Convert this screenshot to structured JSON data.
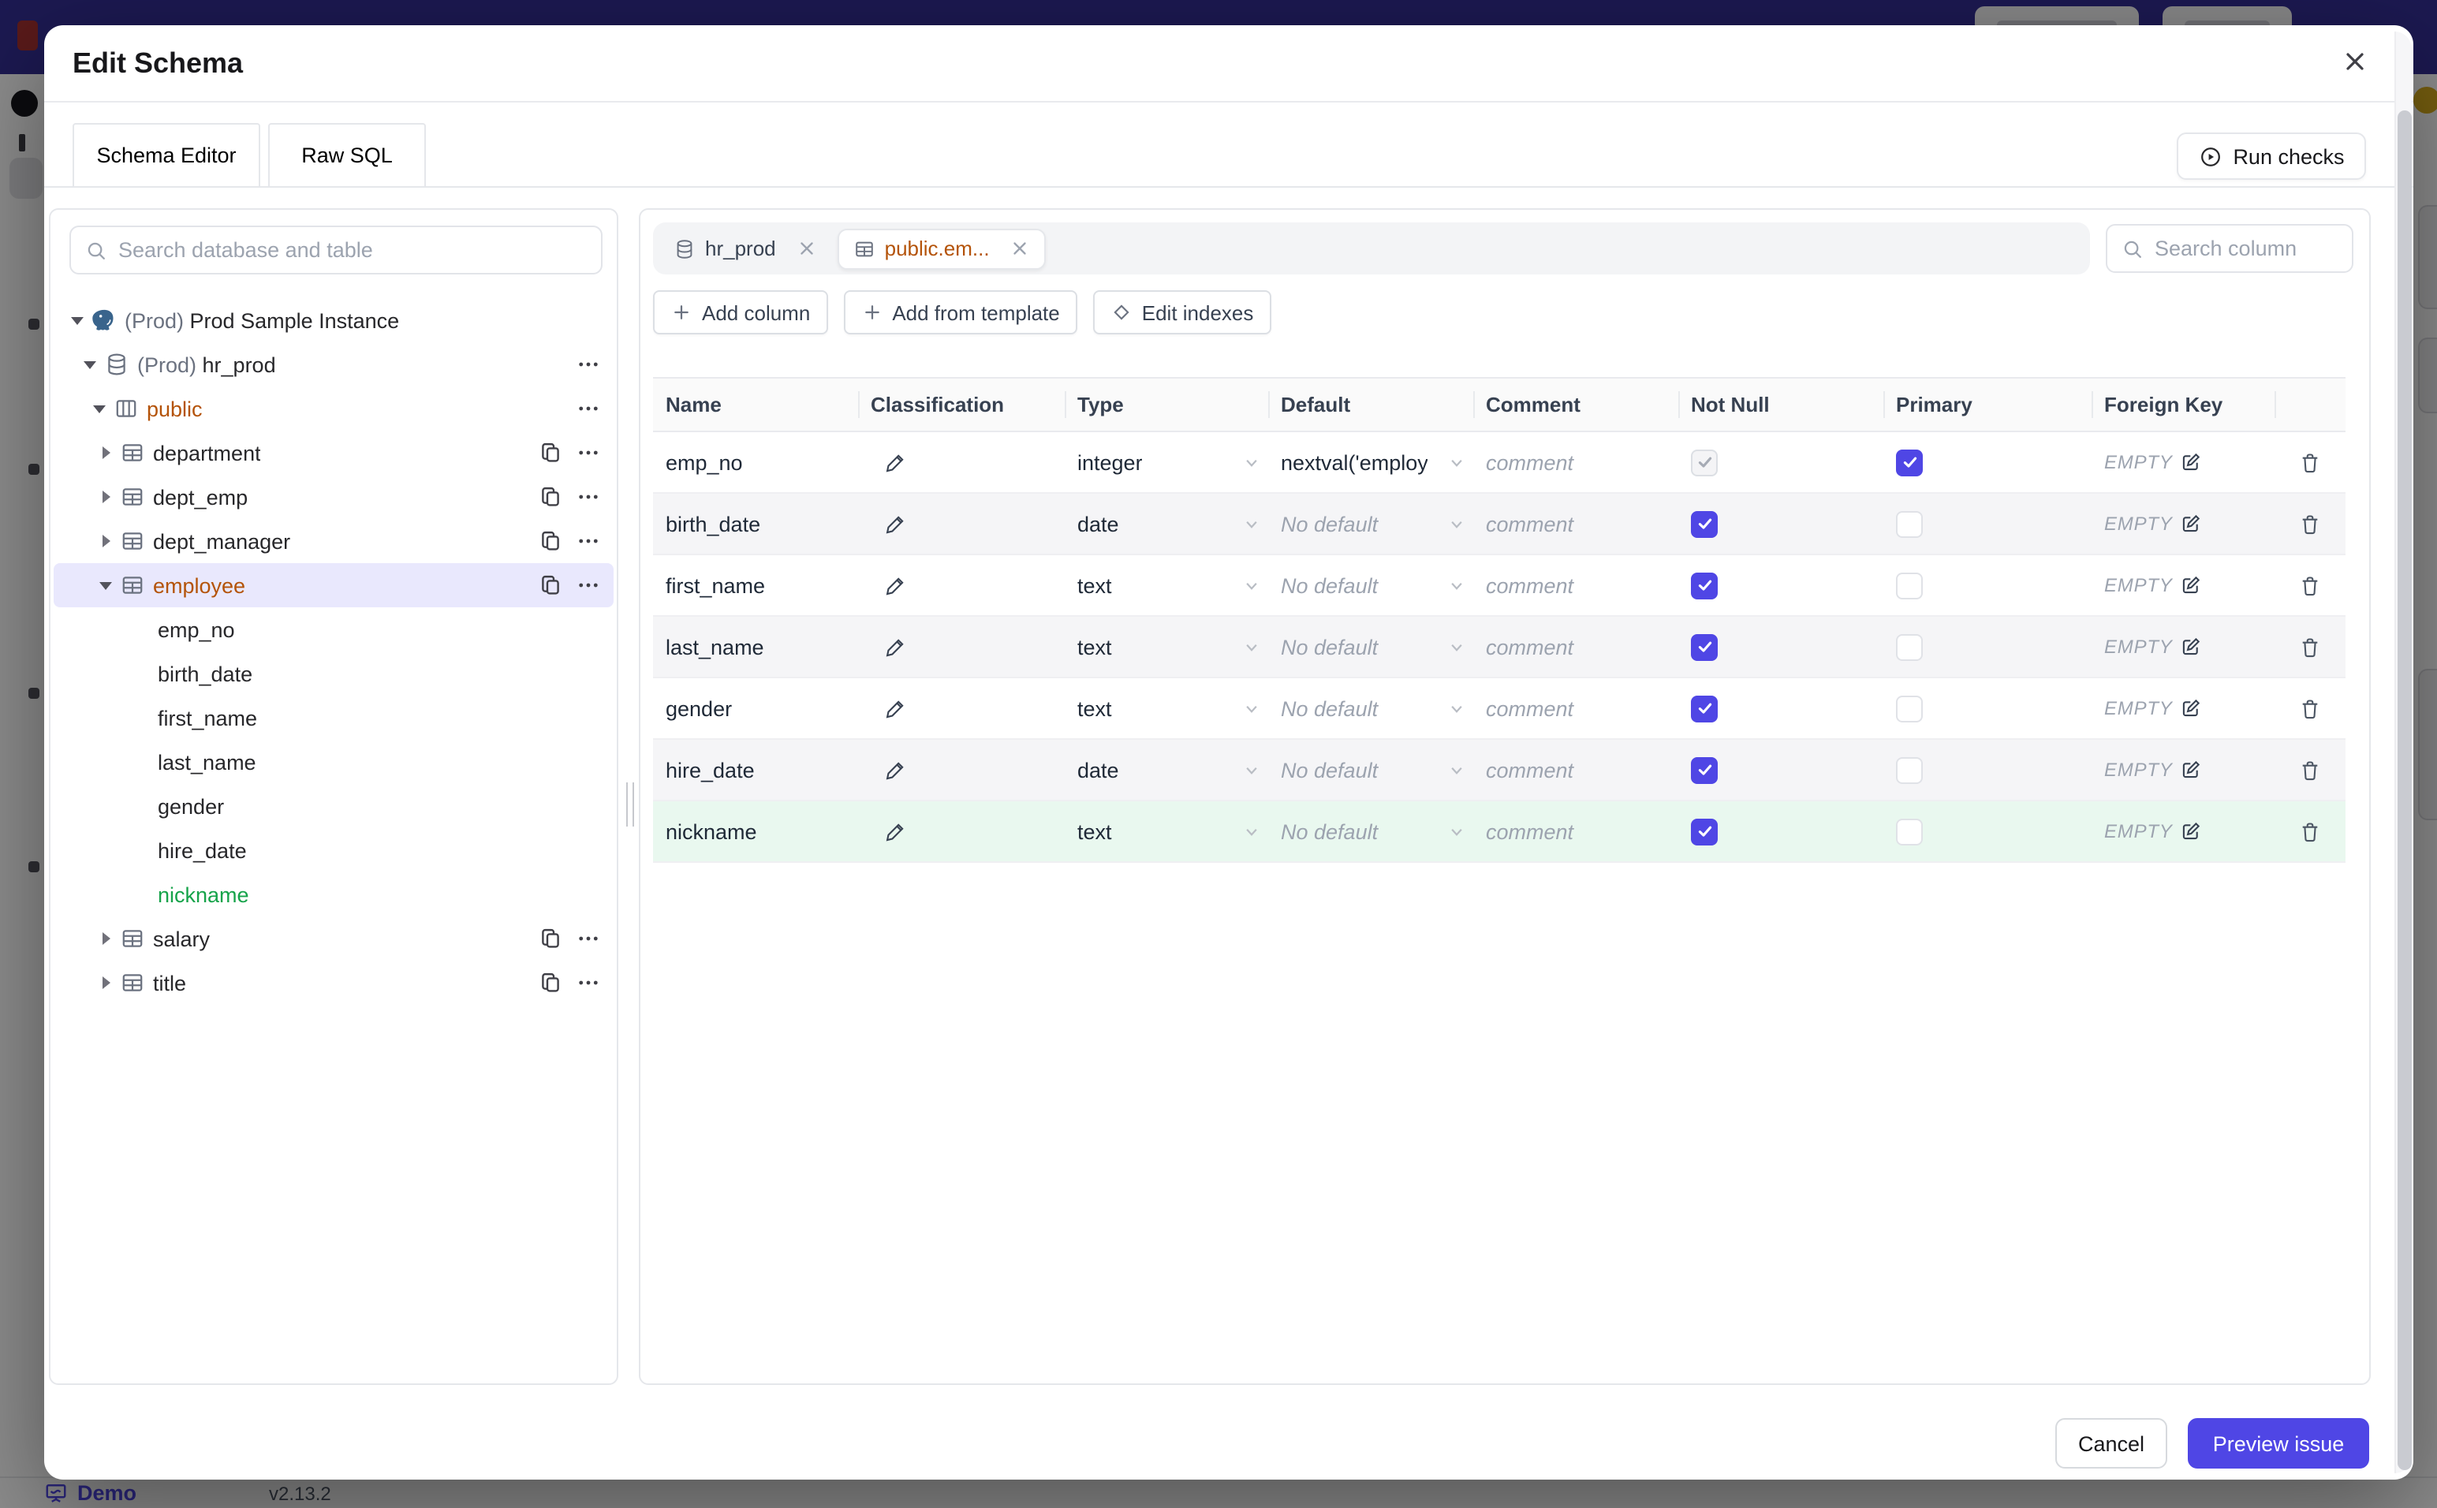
{
  "colors": {
    "accent": "#4f46e5",
    "topbar": "#332e94",
    "modified_amber": "#b45309",
    "added_green": "#16a34a",
    "added_row_bg": "#e9f8ef",
    "selected_tree_bg": "#e9e8fd"
  },
  "backdrop": {
    "footer": {
      "demo_label": "Demo",
      "version": "v2.13.2"
    }
  },
  "modal": {
    "title": "Edit Schema",
    "tabs": [
      {
        "label": "Schema Editor",
        "active": true
      },
      {
        "label": "Raw SQL",
        "active": false
      }
    ],
    "run_checks_label": "Run checks",
    "footer": {
      "cancel_label": "Cancel",
      "preview_label": "Preview issue"
    }
  },
  "sidebar": {
    "search_placeholder": "Search database and table",
    "tree": [
      {
        "level": 0,
        "icon": "postgres",
        "arrow": "expanded",
        "prefix": "(Prod) ",
        "label": "Prod Sample Instance"
      },
      {
        "level": 1,
        "icon": "database",
        "arrow": "expanded",
        "prefix": "(Prod) ",
        "label": "hr_prod",
        "dots": true
      },
      {
        "level": 2,
        "icon": "schema",
        "arrow": "expanded",
        "label": "public",
        "dots": true,
        "state": "modified"
      },
      {
        "level": 3,
        "icon": "table",
        "arrow": "collapsed",
        "label": "department",
        "copy": true,
        "dots": true
      },
      {
        "level": 3,
        "icon": "table",
        "arrow": "collapsed",
        "label": "dept_emp",
        "copy": true,
        "dots": true
      },
      {
        "level": 3,
        "icon": "table",
        "arrow": "collapsed",
        "label": "dept_manager",
        "copy": true,
        "dots": true
      },
      {
        "level": 3,
        "icon": "table",
        "arrow": "expanded",
        "label": "employee",
        "copy": true,
        "dots": true,
        "state": "modified",
        "selected": true
      },
      {
        "level": 4,
        "label": "emp_no"
      },
      {
        "level": 4,
        "label": "birth_date"
      },
      {
        "level": 4,
        "label": "first_name"
      },
      {
        "level": 4,
        "label": "last_name"
      },
      {
        "level": 4,
        "label": "gender"
      },
      {
        "level": 4,
        "label": "hire_date"
      },
      {
        "level": 4,
        "label": "nickname",
        "state": "added"
      },
      {
        "level": 3,
        "icon": "table",
        "arrow": "collapsed",
        "label": "salary",
        "copy": true,
        "dots": true
      },
      {
        "level": 3,
        "icon": "table",
        "arrow": "collapsed",
        "label": "title",
        "copy": true,
        "dots": true
      }
    ]
  },
  "main": {
    "chips": [
      {
        "icon": "database",
        "label": "hr_prod",
        "active": false
      },
      {
        "icon": "table",
        "label": "public.em...",
        "active": true
      }
    ],
    "column_search_placeholder": "Search column",
    "toolbar": [
      {
        "icon": "plus",
        "label": "Add column"
      },
      {
        "icon": "plus",
        "label": "Add from template"
      },
      {
        "icon": "diamond",
        "label": "Edit indexes"
      }
    ],
    "table": {
      "headers": [
        "Name",
        "Classification",
        "Type",
        "Default",
        "Comment",
        "Not Null",
        "Primary",
        "Foreign Key"
      ],
      "comment_placeholder": "comment",
      "no_default_placeholder": "No default",
      "fk_empty_label": "EMPTY",
      "rows": [
        {
          "name": "emp_no",
          "type": "integer",
          "default": "nextval('employ",
          "default_is_placeholder": false,
          "not_null_checked": true,
          "not_null_disabled": true,
          "primary_checked": true,
          "added": false,
          "stripe": false
        },
        {
          "name": "birth_date",
          "type": "date",
          "default": "No default",
          "default_is_placeholder": true,
          "not_null_checked": true,
          "not_null_disabled": false,
          "primary_checked": false,
          "added": false,
          "stripe": true
        },
        {
          "name": "first_name",
          "type": "text",
          "default": "No default",
          "default_is_placeholder": true,
          "not_null_checked": true,
          "not_null_disabled": false,
          "primary_checked": false,
          "added": false,
          "stripe": false
        },
        {
          "name": "last_name",
          "type": "text",
          "default": "No default",
          "default_is_placeholder": true,
          "not_null_checked": true,
          "not_null_disabled": false,
          "primary_checked": false,
          "added": false,
          "stripe": true
        },
        {
          "name": "gender",
          "type": "text",
          "default": "No default",
          "default_is_placeholder": true,
          "not_null_checked": true,
          "not_null_disabled": false,
          "primary_checked": false,
          "added": false,
          "stripe": false
        },
        {
          "name": "hire_date",
          "type": "date",
          "default": "No default",
          "default_is_placeholder": true,
          "not_null_checked": true,
          "not_null_disabled": false,
          "primary_checked": false,
          "added": false,
          "stripe": true
        },
        {
          "name": "nickname",
          "type": "text",
          "default": "No default",
          "default_is_placeholder": true,
          "not_null_checked": true,
          "not_null_disabled": false,
          "primary_checked": false,
          "added": true,
          "stripe": false
        }
      ]
    }
  }
}
